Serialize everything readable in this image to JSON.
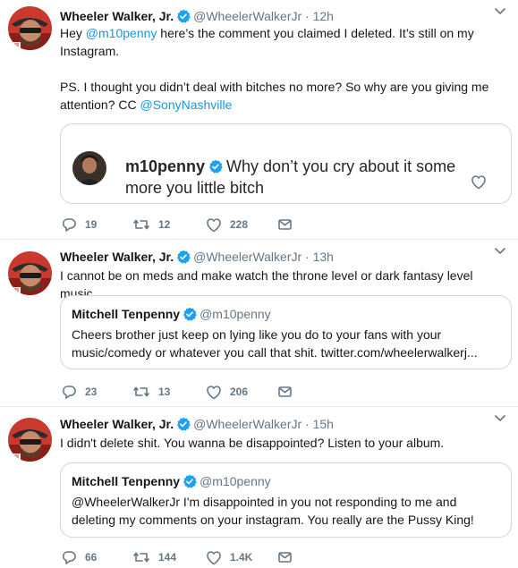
{
  "colors": {
    "link": "#1b95e0",
    "muted": "#657786",
    "border": "#e6ecf0",
    "verified": "#1da1f2"
  },
  "tweets": [
    {
      "name": "Wheeler Walker, Jr.",
      "handle": "@WheelerWalkerJr",
      "sep": " · ",
      "time": "12h",
      "text": {
        "p1a": "Hey ",
        "mention": "@m10penny",
        "p1b": " here’s the comment you claimed I deleted. It’s still on my Instagram.",
        "p2a": "PS. I thought you didn’t deal with bitches no more? So why are you giving me attention? CC ",
        "mention2": "@SonyNashville"
      },
      "instagram": {
        "user": "m10penny",
        "comment": "Why don’t you cry about it some more you little bitch"
      },
      "replies": "19",
      "retweets": "12",
      "likes": "228"
    },
    {
      "name": "Wheeler Walker, Jr.",
      "handle": "@WheelerWalkerJr",
      "sep": " · ",
      "time": "13h",
      "text": "I cannot be on meds and make watch the throne level or dark fantasy level music",
      "quote": {
        "name": "Mitchell Tenpenny",
        "handle": "@m10penny",
        "text": "Cheers brother just keep on lying like you do to your fans with your music/comedy or whatever you call that shit. twitter.com/wheelerwalkerj..."
      },
      "replies": "23",
      "retweets": "13",
      "likes": "206"
    },
    {
      "name": "Wheeler Walker, Jr.",
      "handle": "@WheelerWalkerJr",
      "sep": " · ",
      "time": "15h",
      "text": "I didn't delete shit. You wanna be disappointed? Listen to your album.",
      "quote": {
        "name": "Mitchell Tenpenny",
        "handle": "@m10penny",
        "text": "@WheelerWalkerJr I'm disappointed in you not responding to me and deleting my comments on your instagram. You really are the Pussy King!"
      },
      "replies": "66",
      "retweets": "144",
      "likes": "1.4K"
    }
  ]
}
